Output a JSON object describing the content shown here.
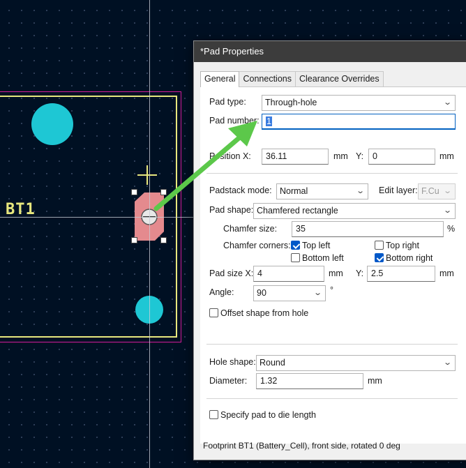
{
  "canvas": {
    "reference_text": "BT1",
    "colors": {
      "background": "#001023",
      "copper_pad": "#1ec7d4",
      "selected_pad": "#e48a8e",
      "silkscreen": "#e8e87e",
      "courtyard": "#d61c9b"
    }
  },
  "dialog": {
    "title": "*Pad Properties",
    "tabs": [
      {
        "label": "General",
        "active": true
      },
      {
        "label": "Connections",
        "active": false
      },
      {
        "label": "Clearance Overrides",
        "active": false
      }
    ],
    "pad_type": {
      "label": "Pad type:",
      "value": "Through-hole"
    },
    "pad_number": {
      "label": "Pad number:",
      "value": "1"
    },
    "position": {
      "x_label": "Position X:",
      "x_value": "36.11",
      "x_unit": "mm",
      "y_label": "Y:",
      "y_value": "0",
      "y_unit": "mm"
    },
    "padstack_mode": {
      "label": "Padstack mode:",
      "value": "Normal"
    },
    "edit_layer": {
      "label": "Edit layer:",
      "value": "F.Cu"
    },
    "pad_shape": {
      "label": "Pad shape:",
      "value": "Chamfered rectangle"
    },
    "chamfer_size": {
      "label": "Chamfer size:",
      "value": "35",
      "unit": "%"
    },
    "chamfer_corners": {
      "label": "Chamfer corners:",
      "top_left": {
        "label": "Top left",
        "checked": true
      },
      "top_right": {
        "label": "Top right",
        "checked": false
      },
      "bottom_left": {
        "label": "Bottom left",
        "checked": false
      },
      "bottom_right": {
        "label": "Bottom right",
        "checked": true
      }
    },
    "pad_size": {
      "x_label": "Pad size X:",
      "x_value": "4",
      "x_unit": "mm",
      "y_label": "Y:",
      "y_value": "2.5",
      "y_unit": "mm"
    },
    "angle": {
      "label": "Angle:",
      "value": "90",
      "unit": "°"
    },
    "offset_shape": {
      "label": "Offset shape from hole",
      "checked": false
    },
    "hole_shape": {
      "label": "Hole shape:",
      "value": "Round"
    },
    "diameter": {
      "label": "Diameter:",
      "value": "1.32",
      "unit": "mm"
    },
    "die_length": {
      "label": "Specify pad to die length",
      "checked": false
    },
    "status_text": "Footprint BT1 (Battery_Cell), front side, rotated 0 deg"
  },
  "annotation": {
    "arrow_color": "#5cc84a"
  }
}
